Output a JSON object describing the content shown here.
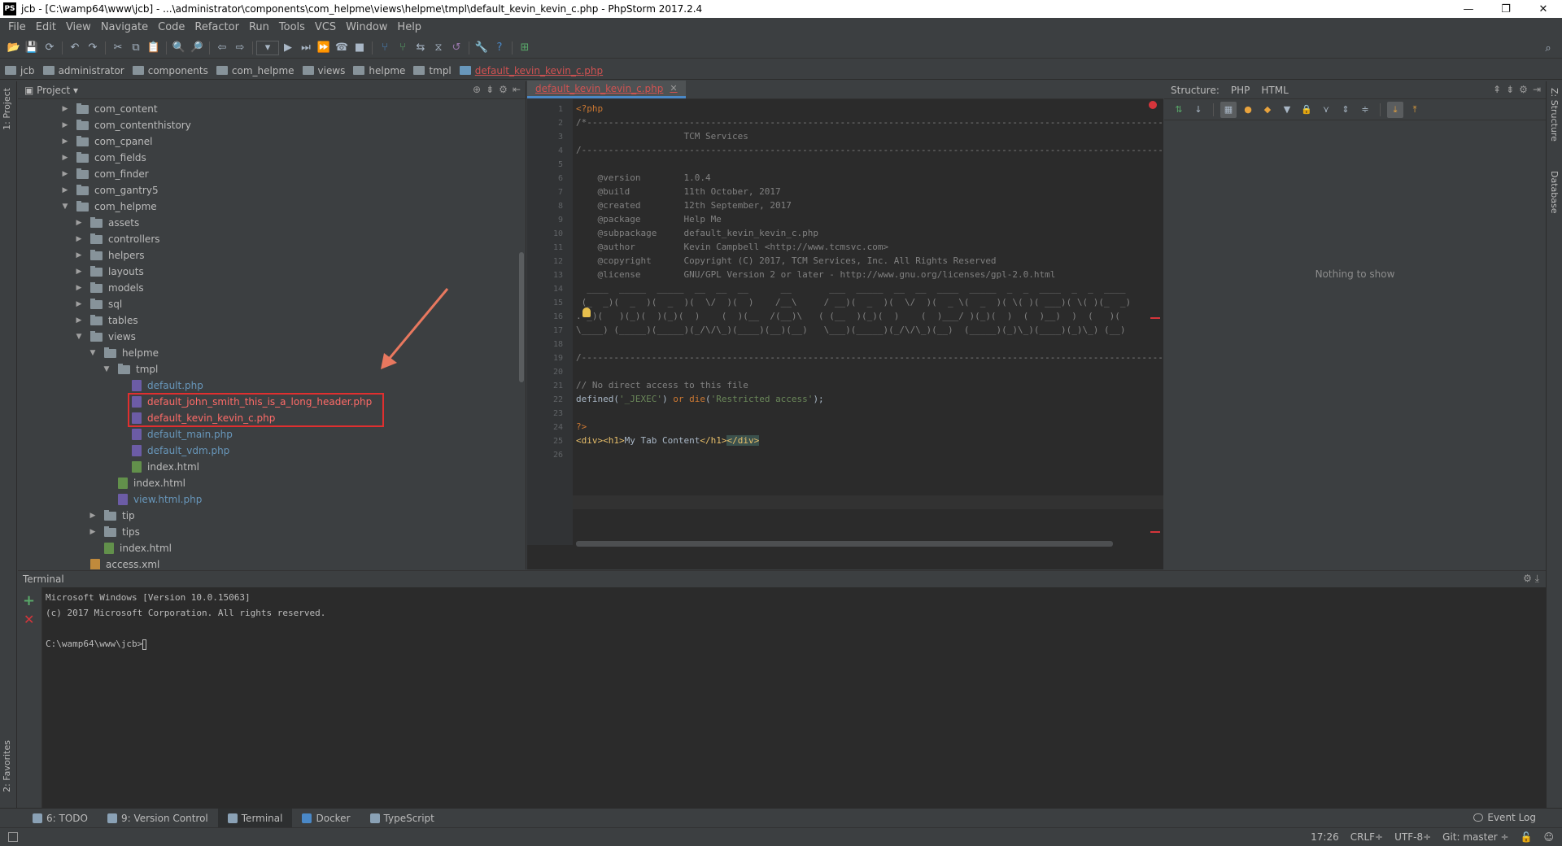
{
  "window": {
    "title": "jcb - [C:\\wamp64\\www\\jcb] - ...\\administrator\\components\\com_helpme\\views\\helpme\\tmpl\\default_kevin_kevin_c.php - PhpStorm 2017.2.4",
    "app_icon": "PS",
    "controls": [
      "—",
      "❐",
      "✕"
    ]
  },
  "menu": [
    "File",
    "Edit",
    "View",
    "Navigate",
    "Code",
    "Refactor",
    "Run",
    "Tools",
    "VCS",
    "Window",
    "Help"
  ],
  "breadcrumb": [
    "jcb",
    "administrator",
    "components",
    "com_helpme",
    "views",
    "helpme",
    "tmpl",
    "default_kevin_kevin_c.php"
  ],
  "left_strip": {
    "project_tab": "1: Project",
    "favorites_tab": "2: Favorites"
  },
  "right_strip": {
    "structure_tab": "Z: Structure",
    "database_tab": "Database"
  },
  "project": {
    "title": "Project",
    "tree": [
      {
        "label": "com_content",
        "indent": 0,
        "type": "folder",
        "expanded": false
      },
      {
        "label": "com_contenthistory",
        "indent": 0,
        "type": "folder",
        "expanded": false
      },
      {
        "label": "com_cpanel",
        "indent": 0,
        "type": "folder",
        "expanded": false
      },
      {
        "label": "com_fields",
        "indent": 0,
        "type": "folder",
        "expanded": false
      },
      {
        "label": "com_finder",
        "indent": 0,
        "type": "folder",
        "expanded": false
      },
      {
        "label": "com_gantry5",
        "indent": 0,
        "type": "folder",
        "expanded": false
      },
      {
        "label": "com_helpme",
        "indent": 0,
        "type": "folder",
        "expanded": true
      },
      {
        "label": "assets",
        "indent": 1,
        "type": "folder",
        "expanded": false
      },
      {
        "label": "controllers",
        "indent": 1,
        "type": "folder",
        "expanded": false
      },
      {
        "label": "helpers",
        "indent": 1,
        "type": "folder",
        "expanded": false
      },
      {
        "label": "layouts",
        "indent": 1,
        "type": "folder",
        "expanded": false
      },
      {
        "label": "models",
        "indent": 1,
        "type": "folder",
        "expanded": false
      },
      {
        "label": "sql",
        "indent": 1,
        "type": "folder",
        "expanded": false
      },
      {
        "label": "tables",
        "indent": 1,
        "type": "folder",
        "expanded": false
      },
      {
        "label": "views",
        "indent": 1,
        "type": "folder",
        "expanded": true
      },
      {
        "label": "helpme",
        "indent": 2,
        "type": "folder",
        "expanded": true
      },
      {
        "label": "tmpl",
        "indent": 3,
        "type": "folder",
        "expanded": true
      },
      {
        "label": "default.php",
        "indent": 4,
        "type": "php",
        "color": "php"
      },
      {
        "label": "default_john_smith_this_is_a_long_header.php",
        "indent": 4,
        "type": "php",
        "color": "err"
      },
      {
        "label": "default_kevin_kevin_c.php",
        "indent": 4,
        "type": "php",
        "color": "err"
      },
      {
        "label": "default_main.php",
        "indent": 4,
        "type": "php",
        "color": "php"
      },
      {
        "label": "default_vdm.php",
        "indent": 4,
        "type": "php",
        "color": "php"
      },
      {
        "label": "index.html",
        "indent": 4,
        "type": "html",
        "color": "plain"
      },
      {
        "label": "index.html",
        "indent": 3,
        "type": "html",
        "color": "plain"
      },
      {
        "label": "view.html.php",
        "indent": 3,
        "type": "php",
        "color": "php"
      },
      {
        "label": "tip",
        "indent": 2,
        "type": "folder",
        "expanded": false
      },
      {
        "label": "tips",
        "indent": 2,
        "type": "folder",
        "expanded": false
      },
      {
        "label": "index.html",
        "indent": 2,
        "type": "html",
        "color": "plain"
      },
      {
        "label": "access.xml",
        "indent": 1,
        "type": "xml",
        "color": "plain"
      }
    ]
  },
  "editor": {
    "tab_label": "default_kevin_kevin_c.php",
    "lines": [
      {
        "n": "1",
        "html": "<span class=\"kw\">&lt;?php</span>"
      },
      {
        "n": "2",
        "html": "/*------------------------------------------------------------------------------------------------------------|  www.vdm.io  |-----"
      },
      {
        "n": "3",
        "html": "                    TCM Services"
      },
      {
        "n": "4",
        "html": "/-----------------------------------------------------------------------------------------------------------------------------------"
      },
      {
        "n": "5",
        "html": ""
      },
      {
        "n": "6",
        "html": "    @version        1.0.4"
      },
      {
        "n": "7",
        "html": "    @build          11th October, 2017"
      },
      {
        "n": "8",
        "html": "    @created        12th September, 2017"
      },
      {
        "n": "9",
        "html": "    @package        Help Me"
      },
      {
        "n": "10",
        "html": "    @subpackage     default_kevin_kevin_c.php"
      },
      {
        "n": "11",
        "html": "    @author         Kevin Campbell &lt;http://www.tcmsvc.com&gt;"
      },
      {
        "n": "12",
        "html": "    @copyright      Copyright (C) 2017, TCM Services, Inc. All Rights Reserved"
      },
      {
        "n": "13",
        "html": "    @license        GNU/GPL Version 2 or later - http://www.gnu.org/licenses/gpl-2.0.html"
      },
      {
        "n": "14",
        "html": "  ____  _____  _____  __  __  __      __       ___  _____  __  __  ____  _____  _  _  ____  _  _  ____"
      },
      {
        "n": "15",
        "html": " (_  _)(  _  )(  _  )(  \\/  )(  )    /__\\     / __)(  _  )(  \\/  )(  _ \\(  _  )( \\( )( ___)( \\( )(_  _)"
      },
      {
        "n": "16",
        "html": ".-_)(   )(_)(  )(_)(  )    (  )(__  /(__)\\   ( (__  )(_)(  )    (  )___/ )(_)(  )  (  )__)  )  (   )("
      },
      {
        "n": "17",
        "html": "\\____) (_____)(_____)(_/\\/\\_)(____)(__)(__)   \\___)(_____)(_/\\/\\_)(__)  (_____)(_)\\_)(____)(_)\\_) (__)"
      },
      {
        "n": "18",
        "html": ""
      },
      {
        "n": "19",
        "html": "/-----------------------------------------------------------------------------------------------------------------------------------"
      },
      {
        "n": "20",
        "html": ""
      },
      {
        "n": "21",
        "html": "// No direct access to this file"
      },
      {
        "n": "22",
        "html": "<span class=\"plain\">defined(</span><span class=\"str\">'_JEXEC'</span><span class=\"plain\">) </span><span class=\"kw\">or die</span><span class=\"plain\">(</span><span class=\"str\">'Restricted access'</span><span class=\"plain\">);</span>"
      },
      {
        "n": "23",
        "html": ""
      },
      {
        "n": "24",
        "html": "<span class=\"kw\">?&gt;</span>"
      },
      {
        "n": "25",
        "html": "<span class=\"tag\">&lt;div&gt;&lt;h1&gt;</span><span class=\"plain\">My Tab Content</span><span class=\"tag\">&lt;/h1&gt;</span><span class=\"tag\" style=\"background:#3b514d\">&lt;/div&gt;</span>"
      },
      {
        "n": "26",
        "html": ""
      }
    ]
  },
  "structure": {
    "title": "Structure:",
    "tabs": [
      "PHP",
      "HTML"
    ],
    "empty_text": "Nothing to show"
  },
  "terminal": {
    "title": "Terminal",
    "lines": [
      "Microsoft Windows [Version 10.0.15063]",
      "(c) 2017 Microsoft Corporation. All rights reserved.",
      "",
      "C:\\wamp64\\www\\jcb>"
    ]
  },
  "bottom_tabs": [
    {
      "label": "6: TODO",
      "active": false
    },
    {
      "label": "9: Version Control",
      "active": false
    },
    {
      "label": "Terminal",
      "active": true
    },
    {
      "label": "Docker",
      "active": false
    },
    {
      "label": "TypeScript",
      "active": false
    }
  ],
  "event_log": "Event Log",
  "status": {
    "position": "17:26",
    "line_sep": "CRLF÷",
    "encoding": "UTF-8÷",
    "vcs": "Git: master ÷"
  }
}
